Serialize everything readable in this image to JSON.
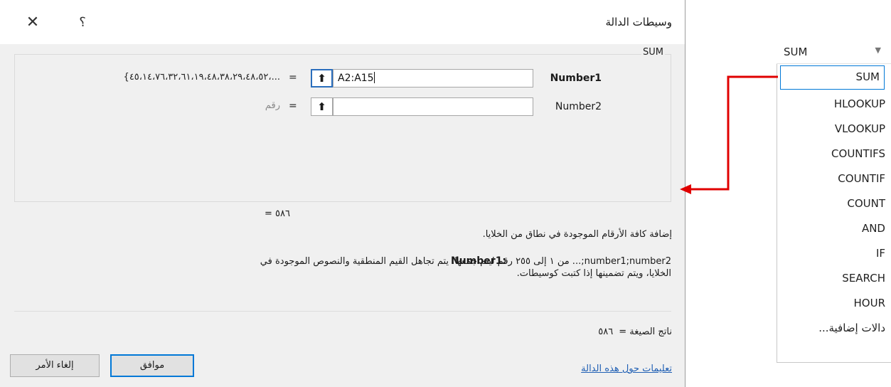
{
  "dialog": {
    "title": "وسيطات الدالة",
    "help_label": "؟",
    "close_label": "✕",
    "group_name": "SUM",
    "args": [
      {
        "name": "Number1",
        "value": "A2:A15",
        "result": "{٤٥،١٤،٧٦،٣٢،٦١،١٩،٤٨،٣٨،٢٩،٤٨،٥٢،...",
        "bold": true
      },
      {
        "name": "Number2",
        "value": "",
        "result": "رقم",
        "bold": false
      }
    ],
    "equals": "=",
    "result_line": "=   ٥٨٦",
    "description": "إضافة كافة الأرقام الموجودة في نطاق من الخلايا.",
    "arg_desc_name": "Number1:",
    "arg_desc_text": "number1;number2;... من ١ إلى ٢٥٥ رقم ليتم جمعها. يتم تجاهل القيم المنطقية والنصوص الموجودة في الخلايا، ويتم تضمينها إذا كتبت كوسيطات.",
    "formula_result_label": "ناتج الصيغة =",
    "formula_result_value": "٥٨٦",
    "help_link": "تعليمات حول هذه الدالة",
    "ok_label": "موافق",
    "cancel_label": "إلغاء الأمر"
  },
  "function_dropdown": {
    "current": "SUM",
    "arrow": "▼",
    "items": [
      "SUM",
      "HLOOKUP",
      "VLOOKUP",
      "COUNTIFS",
      "COUNTIF",
      "COUNT",
      "AND",
      "IF",
      "SEARCH",
      "HOUR",
      "دالات إضافية..."
    ],
    "selected_index": 0
  },
  "colors": {
    "annotation_arrow": "#e00000",
    "link": "#1f5fb4",
    "focus_border": "#0078d7"
  }
}
